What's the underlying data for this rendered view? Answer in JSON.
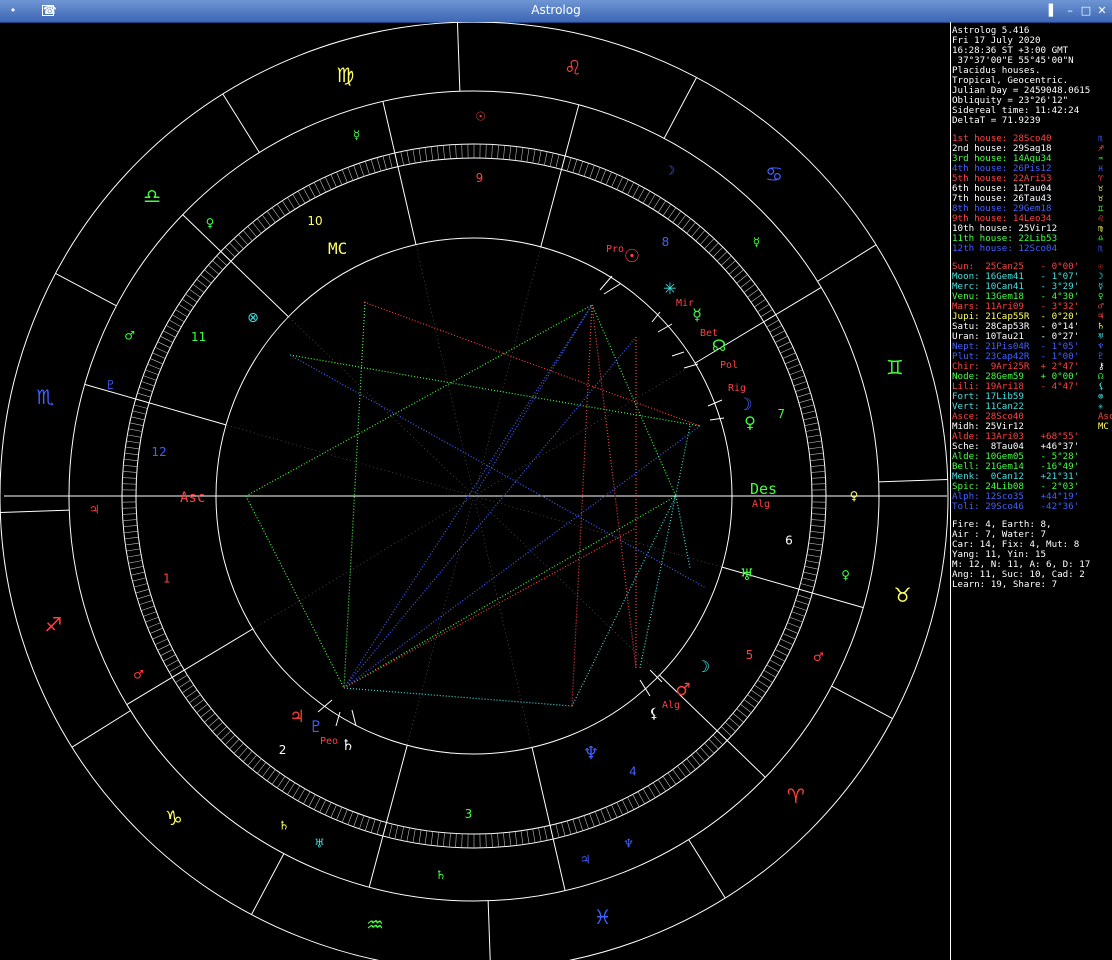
{
  "window": {
    "title": "Astrolog",
    "menu_icon": "menu-dot-icon",
    "app_icon": "astrolog-app-icon",
    "buttons": [
      "shade-button",
      "minimize-button",
      "maximize-button",
      "close-button"
    ],
    "button_glyphs": [
      "▌",
      "–",
      "□",
      "✕"
    ]
  },
  "colors": {
    "title_gradient_top": "#6f96d4",
    "title_gradient_bottom": "#3c66b4",
    "background": "#000000",
    "wheel_lines": "#ffffff",
    "fire": "#ff4040",
    "earth": "#ffff60",
    "air": "#40ff40",
    "water": "#4060ff",
    "cyan": "#40e0e0"
  },
  "info": {
    "header": [
      {
        "text": "Astrolog 5.416",
        "color": "#ffffff"
      },
      {
        "text": "Fri 17 July 2020",
        "color": "#ffffff"
      },
      {
        "text": "16:28:36 ST +3:00 GMT",
        "color": "#ffffff"
      },
      {
        "text": " 37°37'00\"E 55°45'00\"N",
        "color": "#ffffff"
      },
      {
        "text": "Placidus houses.",
        "color": "#ffffff"
      },
      {
        "text": "Tropical, Geocentric.",
        "color": "#ffffff"
      },
      {
        "text": "Julian Day = 2459048.0615",
        "color": "#ffffff"
      },
      {
        "text": "Obliquity = 23°26'12\"",
        "color": "#ffffff"
      },
      {
        "text": "Sidereal time: 11:42:24",
        "color": "#ffffff"
      },
      {
        "text": "DeltaT = 71.9239",
        "color": "#ffffff"
      }
    ],
    "houses": [
      {
        "text": "1st house: 28Sco40",
        "color": "#ff4040",
        "glyph": "♏",
        "glyph_color": "#4060ff"
      },
      {
        "text": "2nd house: 29Sag18",
        "color": "#ffffff",
        "glyph": "♐",
        "glyph_color": "#ff4040"
      },
      {
        "text": "3rd house: 14Aqu34",
        "color": "#40ff40",
        "glyph": "♒",
        "glyph_color": "#40ff40"
      },
      {
        "text": "4th house: 26Pis12",
        "color": "#4060ff",
        "glyph": "♓",
        "glyph_color": "#4060ff"
      },
      {
        "text": "5th house: 22Ari53",
        "color": "#ff4040",
        "glyph": "♈",
        "glyph_color": "#ff4040"
      },
      {
        "text": "6th house: 12Tau04",
        "color": "#ffffff",
        "glyph": "♉",
        "glyph_color": "#ffff60"
      },
      {
        "text": "7th house: 26Tau43",
        "color": "#ffffff",
        "glyph": "♉",
        "glyph_color": "#ffff60"
      },
      {
        "text": "8th house: 29Gem18",
        "color": "#4060ff",
        "glyph": "♊",
        "glyph_color": "#40ff40"
      },
      {
        "text": "9th house: 14Leo34",
        "color": "#ff4040",
        "glyph": "♌",
        "glyph_color": "#ff4040"
      },
      {
        "text": "10th house: 25Vir12",
        "color": "#ffffff",
        "glyph": "♍",
        "glyph_color": "#ffff60"
      },
      {
        "text": "11th house: 22Lib53",
        "color": "#40ff40",
        "glyph": "♎",
        "glyph_color": "#40ff40"
      },
      {
        "text": "12th house: 12Sco04",
        "color": "#4060ff",
        "glyph": "♏",
        "glyph_color": "#4060ff"
      }
    ],
    "planets": [
      {
        "text": "Sun:  25Can25   - 0°00'",
        "color": "#ff4040",
        "glyph": "☉",
        "glyph_color": "#ff4040"
      },
      {
        "text": "Moon: 16Gem41   - 1°07'",
        "color": "#40e0e0",
        "glyph": "☽",
        "glyph_color": "#40e0e0"
      },
      {
        "text": "Merc: 10Can41   - 3°29'",
        "color": "#40e0e0",
        "glyph": "☿",
        "glyph_color": "#40e0e0"
      },
      {
        "text": "Venu: 13Gem18   - 4°30'",
        "color": "#40ff40",
        "glyph": "♀",
        "glyph_color": "#40ff40"
      },
      {
        "text": "Mars: 11Ari09   - 3°32'",
        "color": "#ff4040",
        "glyph": "♂",
        "glyph_color": "#ff4040"
      },
      {
        "text": "Jupi: 21Cap55R  - 0°20'",
        "color": "#ffff60",
        "glyph": "♃",
        "glyph_color": "#ff4040"
      },
      {
        "text": "Satu: 28Cap53R  - 0°14'",
        "color": "#ffffff",
        "glyph": "♄",
        "glyph_color": "#ffff60"
      },
      {
        "text": "Uran: 10Tau21   - 0°27'",
        "color": "#ffffff",
        "glyph": "♅",
        "glyph_color": "#40e0e0"
      },
      {
        "text": "Nept: 21Pis04R  - 1°05'",
        "color": "#4060ff",
        "glyph": "♆",
        "glyph_color": "#4060ff"
      },
      {
        "text": "Plut: 23Cap42R  - 1°00'",
        "color": "#4060ff",
        "glyph": "♇",
        "glyph_color": "#4060ff"
      },
      {
        "text": "Chir:  9Ari25R  + 2°47'",
        "color": "#ff4040",
        "glyph": "⚷",
        "glyph_color": "#ffffff"
      },
      {
        "text": "Node: 28Gem59   + 0°00'",
        "color": "#40ff40",
        "glyph": "☊",
        "glyph_color": "#40ff40"
      },
      {
        "text": "Lili: 19Ari18   - 4°47'",
        "color": "#ff4040",
        "glyph": "⚸",
        "glyph_color": "#40e0e0"
      },
      {
        "text": "Fort: 17Lib59",
        "color": "#40e0e0",
        "glyph": "⊗",
        "glyph_color": "#40e0e0"
      },
      {
        "text": "Vert: 11Can22",
        "color": "#40e0e0",
        "glyph": "✳",
        "glyph_color": "#40e0e0"
      },
      {
        "text": "Asce: 28Sco40",
        "color": "#ff4040",
        "glyph": "Asc",
        "glyph_color": "#ff4040"
      },
      {
        "text": "Midh: 25Vir12",
        "color": "#ffffff",
        "glyph": "MC",
        "glyph_color": "#ffff60"
      },
      {
        "text": "Alde: 13Ari03   +68°55'",
        "color": "#ff4040",
        "glyph": "",
        "glyph_color": "#ff4040"
      },
      {
        "text": "Sche:  8Tau04   +46°37'",
        "color": "#ffffff",
        "glyph": "",
        "glyph_color": "#ffffff"
      },
      {
        "text": "Alde: 10Gem05   - 5°28'",
        "color": "#40ff40",
        "glyph": "",
        "glyph_color": "#40ff40"
      },
      {
        "text": "Bell: 21Gem14   -16°49'",
        "color": "#40ff40",
        "glyph": "",
        "glyph_color": "#40ff40"
      },
      {
        "text": "Menk:  0Can12   +21°31'",
        "color": "#40e0e0",
        "glyph": "",
        "glyph_color": "#40e0e0"
      },
      {
        "text": "Spic: 24Lib08   - 2°03'",
        "color": "#40ff40",
        "glyph": "",
        "glyph_color": "#40ff40"
      },
      {
        "text": "Alph: 12Sco35   +44°19'",
        "color": "#4060ff",
        "glyph": "",
        "glyph_color": "#4060ff"
      },
      {
        "text": "Toli: 29Sco46   -42°36'",
        "color": "#4060ff",
        "glyph": "",
        "glyph_color": "#4060ff"
      }
    ],
    "summary": [
      {
        "text": "Fire: 4, Earth: 8,",
        "color": "#ffffff"
      },
      {
        "text": "Air : 7, Water: 7",
        "color": "#ffffff"
      },
      {
        "text": "Car: 14, Fix: 4, Mut: 8",
        "color": "#ffffff"
      },
      {
        "text": "Yang: 11, Yin: 15",
        "color": "#ffffff"
      },
      {
        "text": "M: 12, N: 11, A: 6, D: 17",
        "color": "#ffffff"
      },
      {
        "text": "Ang: 11, Suc: 10, Cad: 2",
        "color": "#ffffff"
      },
      {
        "text": "Learn: 19, Share: 7",
        "color": "#ffffff"
      }
    ]
  },
  "wheel": {
    "asc_label": "Asc",
    "des_label": "Des",
    "mc_label": "MC",
    "cusp_angles": [
      180,
      149,
      105,
      77,
      44,
      16,
      0,
      329,
      285,
      257,
      224,
      196
    ],
    "house_numbers": [
      {
        "n": "1",
        "ang": 165,
        "color": "#ff4040"
      },
      {
        "n": "2",
        "ang": 127,
        "color": "#ffffff"
      },
      {
        "n": "3",
        "ang": 91,
        "color": "#40ff40"
      },
      {
        "n": "4",
        "ang": 60,
        "color": "#4060ff"
      },
      {
        "n": "5",
        "ang": 30,
        "color": "#ff4040"
      },
      {
        "n": "6",
        "ang": 8,
        "color": "#ffffff"
      },
      {
        "n": "7",
        "ang": 345,
        "color": "#40ff40"
      },
      {
        "n": "8",
        "ang": 307,
        "color": "#4060ff"
      },
      {
        "n": "9",
        "ang": 271,
        "color": "#ff4040"
      },
      {
        "n": "10",
        "ang": 240,
        "color": "#ffff60"
      },
      {
        "n": "11",
        "ang": 210,
        "color": "#40ff40"
      },
      {
        "n": "12",
        "ang": 188,
        "color": "#4060ff"
      }
    ],
    "signs": [
      {
        "g": "♐",
        "ang": 163,
        "color": "#ff4040"
      },
      {
        "g": "♑",
        "ang": 133,
        "color": "#ffff60"
      },
      {
        "g": "♒",
        "ang": 103,
        "color": "#40ff40"
      },
      {
        "g": "♓",
        "ang": 73,
        "color": "#4060ff"
      },
      {
        "g": "♈",
        "ang": 43,
        "color": "#ff4040"
      },
      {
        "g": "♉",
        "ang": 13,
        "color": "#ffff60"
      },
      {
        "g": "♊",
        "ang": 343,
        "color": "#40ff40"
      },
      {
        "g": "♋",
        "ang": 313,
        "color": "#4060ff"
      },
      {
        "g": "♌",
        "ang": 283,
        "color": "#ff4040"
      },
      {
        "g": "♍",
        "ang": 253,
        "color": "#ffff60"
      },
      {
        "g": "♎",
        "ang": 223,
        "color": "#40ff40"
      },
      {
        "g": "♏",
        "ang": 193,
        "color": "#4060ff"
      }
    ],
    "rulers": [
      {
        "g": "♃",
        "ang": 178,
        "color": "#ff4040"
      },
      {
        "g": "♂",
        "ang": 152,
        "color": "#ff4040"
      },
      {
        "g": "♄",
        "ang": 120,
        "color": "#ffff60"
      },
      {
        "g": "♅",
        "ang": 114,
        "color": "#40e0e0"
      },
      {
        "g": "♄",
        "ang": 95,
        "color": "#40ff40"
      },
      {
        "g": "♃",
        "ang": 73,
        "color": "#4060ff"
      },
      {
        "g": "♆",
        "ang": 66,
        "color": "#4060ff"
      },
      {
        "g": "♂",
        "ang": 25,
        "color": "#ff4040"
      },
      {
        "g": "♀",
        "ang": 0,
        "color": "#ffff60"
      },
      {
        "g": "♀",
        "ang": 12,
        "color": "#40ff40"
      },
      {
        "g": "☿",
        "ang": 318,
        "color": "#40ff40"
      },
      {
        "g": "☽",
        "ang": 301,
        "color": "#4060ff"
      },
      {
        "g": "☉",
        "ang": 271,
        "color": "#ff4040"
      },
      {
        "g": "☿",
        "ang": 252,
        "color": "#40ff40"
      },
      {
        "g": "♀",
        "ang": 226,
        "color": "#40ff40"
      },
      {
        "g": "♇",
        "ang": 197,
        "color": "#4060ff"
      },
      {
        "g": "♂",
        "ang": 205,
        "color": "#40ff40"
      }
    ]
  },
  "planet_labels": [
    "Pro",
    "Mir",
    "Bet",
    "Pol",
    "Rig",
    "Alg",
    "Alg",
    "Peo"
  ]
}
